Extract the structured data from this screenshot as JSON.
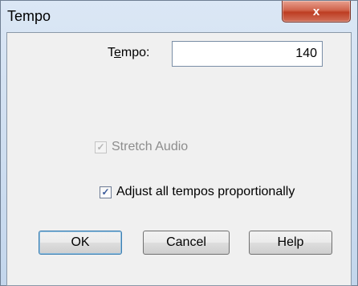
{
  "window": {
    "title": "Tempo",
    "close_glyph": "x"
  },
  "tempo_field": {
    "label_before": "T",
    "label_underlined": "e",
    "label_after": "mpo:",
    "value": "140"
  },
  "stretch_audio": {
    "label": "Stretch Audio",
    "checked": true,
    "enabled": false
  },
  "adjust_tempos": {
    "label": "Adjust all tempos proportionally",
    "checked": true,
    "enabled": true
  },
  "buttons": {
    "ok": "OK",
    "cancel": "Cancel",
    "help": "Help"
  },
  "colors": {
    "dialog_bg": "#f0f0f0",
    "close_button": "#c9462c",
    "frame": "#c3d6ec"
  }
}
